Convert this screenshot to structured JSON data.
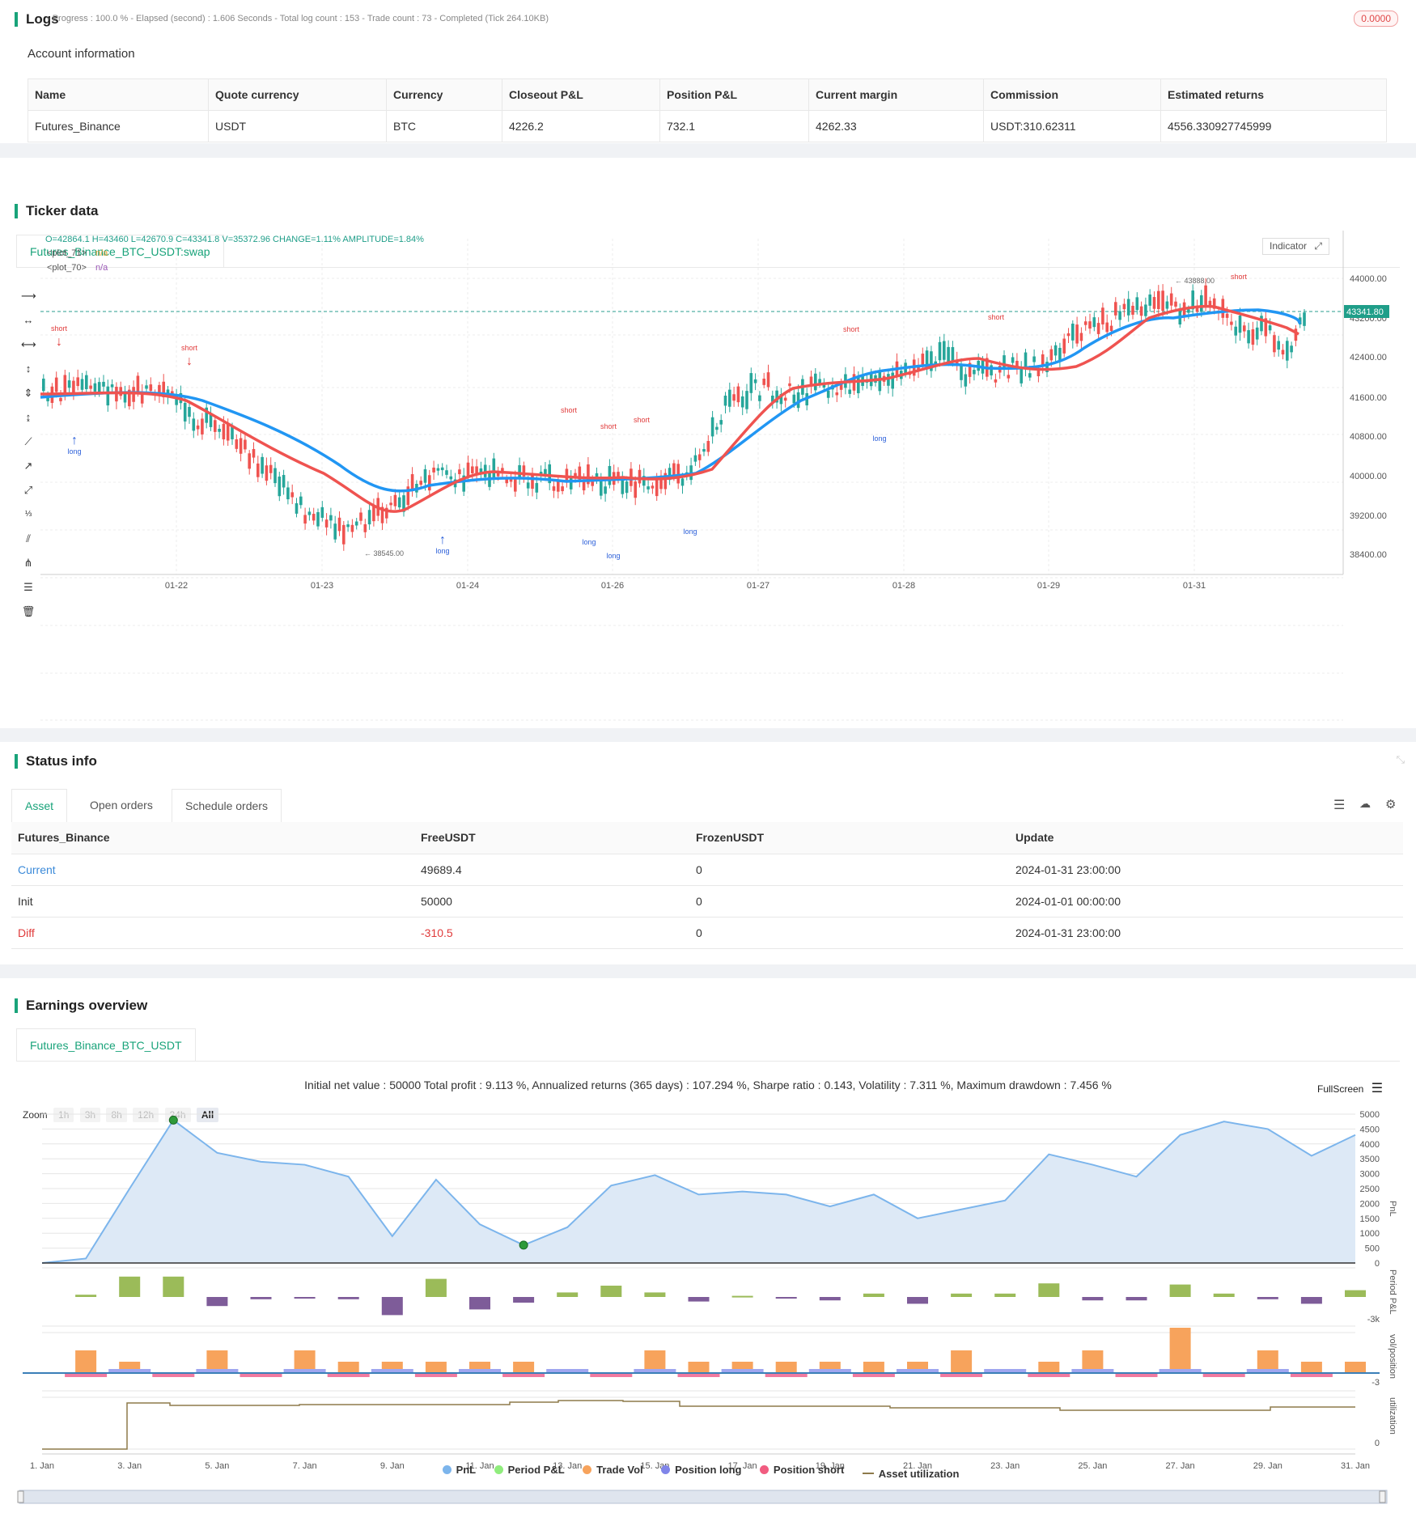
{
  "logs": {
    "title": "Logs",
    "summary": "- Progress : 100.0 % - Elapsed (second) : 1.606  Seconds - Total log count : 153 - Trade count : 73 - Completed (Tick 264.10KB)",
    "badge": "0.0000"
  },
  "account": {
    "title": "Account information",
    "headers": [
      "Name",
      "Quote currency",
      "Currency",
      "Closeout P&L",
      "Position P&L",
      "Current margin",
      "Commission",
      "Estimated returns"
    ],
    "row": [
      "Futures_Binance",
      "USDT",
      "BTC",
      "4226.2",
      "732.1",
      "4262.33",
      "USDT:310.62311",
      "4556.330927745999"
    ]
  },
  "ticker": {
    "title": "Ticker data",
    "tab": "Futures_Binance_BTC_USDT:swap",
    "ohlc": "O=42864.1 H=43460 L=42670.9 C=43341.8 V=35372.96 CHANGE=1.11% AMPLITUDE=1.84%",
    "plot71_label": "<plot_71>",
    "plot71_value": "n/a",
    "plot70_label": "<plot_70>",
    "plot70_value": "n/a",
    "indicator_button": "Indicator",
    "price_tag": "43341.80",
    "high_label": "43888.00",
    "low_label": "38545.00",
    "y_ticks": [
      "44000.00",
      "43200.00",
      "42400.00",
      "41600.00",
      "40800.00",
      "40000.00",
      "39200.00",
      "38400.00"
    ],
    "x_ticks": [
      "01-22",
      "01-23",
      "01-24",
      "01-26",
      "01-27",
      "01-28",
      "01-29",
      "01-31"
    ]
  },
  "status": {
    "title": "Status info",
    "tabs": [
      "Asset",
      "Open orders",
      "Schedule orders"
    ],
    "headers": [
      "Futures_Binance",
      "FreeUSDT",
      "FrozenUSDT",
      "Update"
    ],
    "rows": [
      {
        "name": "Current",
        "free": "49689.4",
        "frozen": "0",
        "update": "2024-01-31 23:00:00"
      },
      {
        "name": "Init",
        "free": "50000",
        "frozen": "0",
        "update": "2024-01-01 00:00:00"
      },
      {
        "name": "Diff",
        "free": "-310.5",
        "frozen": "0",
        "update": "2024-01-31 23:00:00"
      }
    ]
  },
  "earnings": {
    "title": "Earnings overview",
    "tab": "Futures_Binance_BTC_USDT",
    "summary": "Initial net value : 50000 Total profit : 9.113 %, Annualized returns (365 days) : 107.294 %, Sharpe ratio : 0.143, Volatility : 7.311 %, Maximum drawdown : 7.456 %",
    "fullscreen": "FullScreen",
    "zoom_label": "Zoom",
    "zoom_buttons": [
      "1h",
      "3h",
      "8h",
      "12h",
      "24h",
      "All"
    ],
    "pnl_ticks": [
      "5000",
      "4500",
      "4000",
      "3500",
      "3000",
      "2500",
      "2000",
      "1500",
      "1000",
      "500",
      "0"
    ],
    "axis_pnl": "PnL",
    "axis_period": "Period P&L",
    "period_tick": "-3k",
    "axis_vol": "vol/position",
    "vol_tick": "-3",
    "axis_util": "utilization",
    "util_tick": "0",
    "x_ticks": [
      "1. Jan",
      "3. Jan",
      "5. Jan",
      "7. Jan",
      "9. Jan",
      "11. Jan",
      "13. Jan",
      "15. Jan",
      "17. Jan",
      "19. Jan",
      "21. Jan",
      "23. Jan",
      "25. Jan",
      "27. Jan",
      "29. Jan",
      "31. Jan"
    ],
    "legend": [
      {
        "label": "PnL",
        "color": "#7cb5ec"
      },
      {
        "label": "Period P&L",
        "color": "#90ed7d"
      },
      {
        "label": "Trade Vol",
        "color": "#f7a35c"
      },
      {
        "label": "Position long",
        "color": "#8085e9"
      },
      {
        "label": "Position short",
        "color": "#f15c80"
      },
      {
        "label": "Asset utilization",
        "color": "#8d7a4a"
      }
    ],
    "chart_data": {
      "type": "area",
      "title": "",
      "x": [
        "1. Jan",
        "2. Jan",
        "3. Jan",
        "4. Jan",
        "5. Jan",
        "6. Jan",
        "7. Jan",
        "8. Jan",
        "9. Jan",
        "10. Jan",
        "11. Jan",
        "12. Jan",
        "13. Jan",
        "14. Jan",
        "15. Jan",
        "16. Jan",
        "17. Jan",
        "18. Jan",
        "19. Jan",
        "20. Jan",
        "21. Jan",
        "22. Jan",
        "23. Jan",
        "24. Jan",
        "25. Jan",
        "26. Jan",
        "27. Jan",
        "28. Jan",
        "29. Jan",
        "30. Jan",
        "31. Jan"
      ],
      "series": [
        {
          "name": "PnL",
          "values": [
            0,
            150,
            2500,
            4800,
            3700,
            3400,
            3300,
            2900,
            900,
            2800,
            1300,
            600,
            1200,
            2600,
            2950,
            2300,
            2400,
            2300,
            1900,
            2300,
            1500,
            1800,
            2100,
            3650,
            3300,
            2900,
            4300,
            4750,
            4500,
            3600,
            4300
          ]
        },
        {
          "name": "Period P&L",
          "values": [
            0,
            200,
            1800,
            1800,
            -800,
            -200,
            -100,
            -200,
            -1600,
            1600,
            -1100,
            -500,
            400,
            1000,
            400,
            -400,
            100,
            -100,
            -300,
            300,
            -600,
            300,
            300,
            1200,
            -300,
            -300,
            1100,
            300,
            -200,
            -600,
            600
          ]
        },
        {
          "name": "Trade Vol",
          "values": [
            0,
            2,
            1,
            0,
            2,
            0,
            2,
            1,
            1,
            1,
            1,
            1,
            0,
            0,
            2,
            1,
            1,
            1,
            1,
            1,
            1,
            2,
            0,
            1,
            2,
            0,
            4,
            0,
            2,
            1,
            1
          ]
        }
      ],
      "ylim": [
        0,
        5000
      ]
    }
  }
}
